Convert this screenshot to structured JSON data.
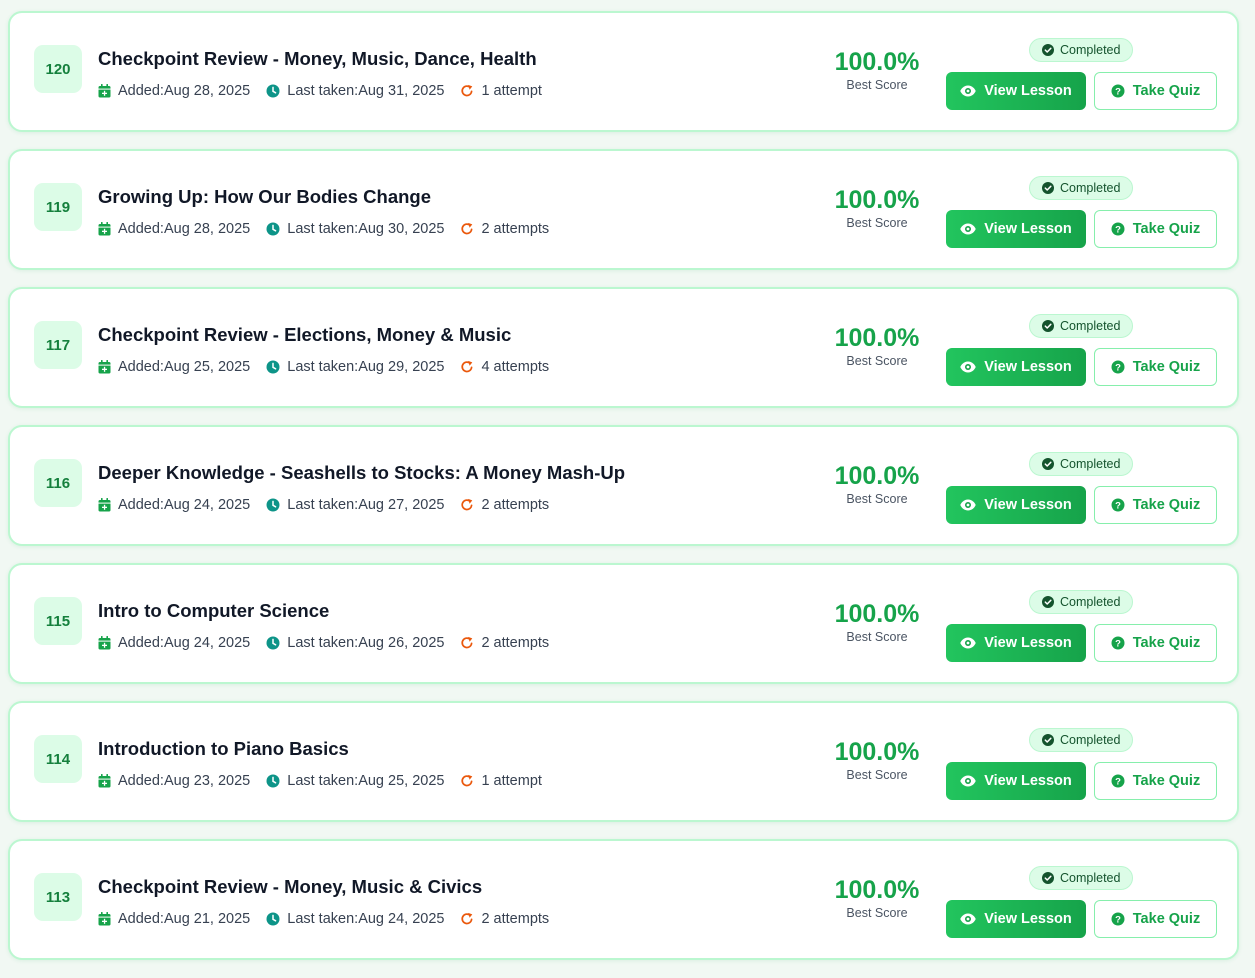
{
  "labels": {
    "added_prefix": "Added: ",
    "last_taken_prefix": "Last taken: ",
    "best_score": "Best Score",
    "completed": "Completed",
    "view_lesson": "View Lesson",
    "take_quiz": "Take Quiz"
  },
  "colors": {
    "accent": "#16a34a",
    "card_border": "#bbf7d0",
    "badge_bg": "#dcfce7",
    "attempt_icon": "#ea580c",
    "clock_icon": "#0d9488"
  },
  "icons": {
    "added": "calendar-plus-icon",
    "last_taken": "clock-icon",
    "attempts": "redo-icon",
    "completed": "check-circle-icon",
    "view": "eye-icon",
    "quiz": "question-circle-icon"
  },
  "lessons": [
    {
      "number": "120",
      "title": "Checkpoint Review - Money, Music, Dance, Health",
      "added": "Aug 28, 2025",
      "last_taken": "Aug 31, 2025",
      "attempts": "1 attempt",
      "score": "100.0%"
    },
    {
      "number": "119",
      "title": "Growing Up: How Our Bodies Change",
      "added": "Aug 28, 2025",
      "last_taken": "Aug 30, 2025",
      "attempts": "2 attempts",
      "score": "100.0%"
    },
    {
      "number": "117",
      "title": "Checkpoint Review - Elections, Money & Music",
      "added": "Aug 25, 2025",
      "last_taken": "Aug 29, 2025",
      "attempts": "4 attempts",
      "score": "100.0%"
    },
    {
      "number": "116",
      "title": "Deeper Knowledge - Seashells to Stocks: A Money Mash-Up",
      "added": "Aug 24, 2025",
      "last_taken": "Aug 27, 2025",
      "attempts": "2 attempts",
      "score": "100.0%"
    },
    {
      "number": "115",
      "title": "Intro to Computer Science",
      "added": "Aug 24, 2025",
      "last_taken": "Aug 26, 2025",
      "attempts": "2 attempts",
      "score": "100.0%"
    },
    {
      "number": "114",
      "title": "Introduction to Piano Basics",
      "added": "Aug 23, 2025",
      "last_taken": "Aug 25, 2025",
      "attempts": "1 attempt",
      "score": "100.0%"
    },
    {
      "number": "113",
      "title": "Checkpoint Review - Money, Music & Civics",
      "added": "Aug 21, 2025",
      "last_taken": "Aug 24, 2025",
      "attempts": "2 attempts",
      "score": "100.0%"
    }
  ]
}
